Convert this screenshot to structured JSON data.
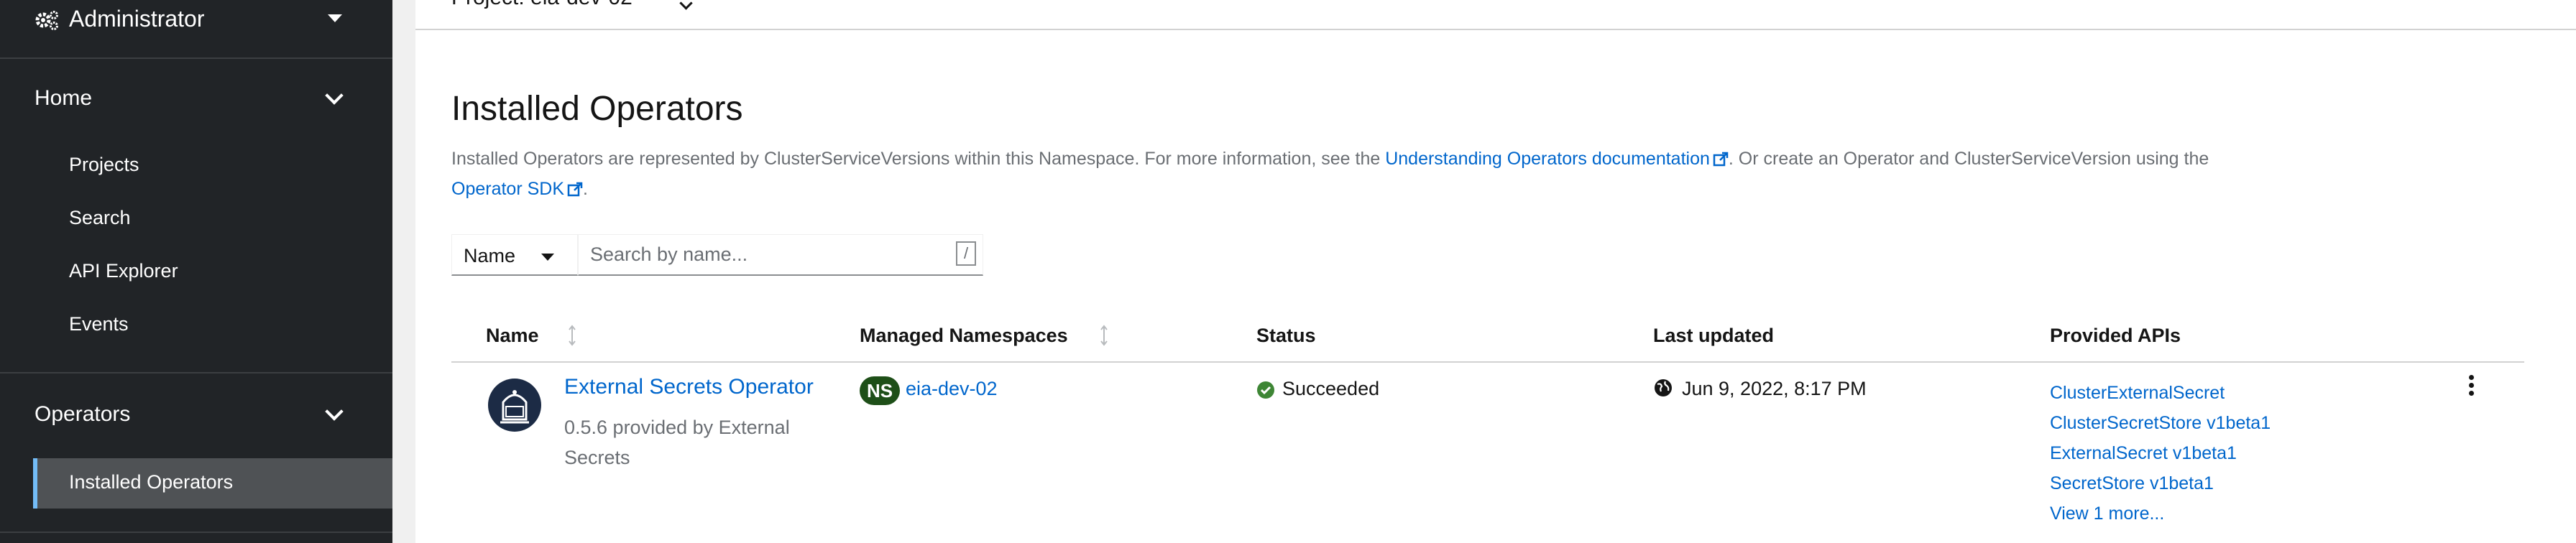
{
  "sidebar": {
    "perspective": {
      "label": "Administrator",
      "icon": "gears-icon"
    },
    "sections": [
      {
        "label": "Home",
        "items": [
          "Projects",
          "Search",
          "API Explorer",
          "Events"
        ]
      },
      {
        "label": "Operators",
        "items": [
          "Installed Operators"
        ],
        "active": "Installed Operators"
      }
    ]
  },
  "project_bar": {
    "label": "Project: eia-dev-02"
  },
  "page": {
    "title": "Installed Operators",
    "description_part1": "Installed Operators are represented by ClusterServiceVersions within this Namespace. For more information, see the ",
    "description_link1": "Understanding Operators documentation",
    "description_part2": ". Or create an Operator and ClusterServiceVersion using the ",
    "description_link2": "Operator SDK",
    "description_part3": "."
  },
  "filter": {
    "type": "Name",
    "placeholder": "Search by name...",
    "shortcut": "/"
  },
  "table": {
    "columns": [
      "Name",
      "Managed Namespaces",
      "Status",
      "Last updated",
      "Provided APIs"
    ],
    "rows": [
      {
        "name": "External Secrets Operator",
        "provider": "0.5.6 provided by External Secrets",
        "ns_badge": "NS",
        "namespace": "eia-dev-02",
        "status": "Succeeded",
        "last_updated": "Jun 9, 2022, 8:17 PM",
        "apis": [
          "ClusterExternalSecret",
          "ClusterSecretStore v1beta1",
          "ExternalSecret v1beta1",
          "SecretStore v1beta1",
          "View 1 more..."
        ]
      }
    ]
  },
  "colors": {
    "link": "#0066cc",
    "success": "#3e8635",
    "ns_badge": "#1e4f18",
    "sidebar_bg": "#212427",
    "active_border": "#73bcf7"
  }
}
